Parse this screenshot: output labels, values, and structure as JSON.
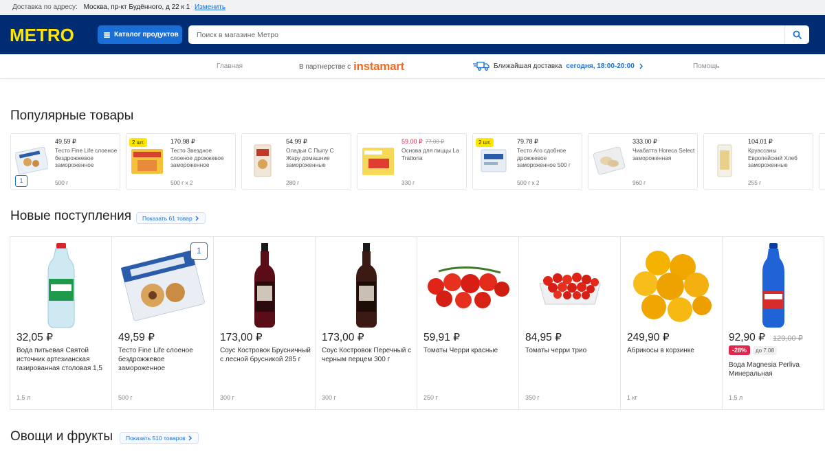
{
  "address_bar": {
    "label": "Доставка по адресу:",
    "address": "Москва, пр-кт Будённого, д 22 к 1",
    "change": "Изменить"
  },
  "header": {
    "logo": "METRO",
    "catalog_label": "Каталог продуктов",
    "search_placeholder": "Поиск в магазине Метро"
  },
  "nav": {
    "home": "Главная",
    "partner_prefix": "В партнерстве с",
    "partner_brand": "instamart",
    "delivery_label": "Ближайшая доставка",
    "delivery_time": "сегодня, 18:00-20:00",
    "help": "Помощь"
  },
  "popular": {
    "title": "Популярные товары",
    "items": [
      {
        "price": "49.59 ₽",
        "name": "Тесто Fine Life слоеное бездрожжевое замороженное",
        "weight": "500 г",
        "qty": "1"
      },
      {
        "price": "170.98 ₽",
        "name": "Тесто Звездное слоеное дрожжевое замороженное",
        "weight": "500 г x 2",
        "multi": "2 шт."
      },
      {
        "price": "54.99 ₽",
        "name": "Оладьи С Пылу С Жару домашние замороженные",
        "weight": "280 г"
      },
      {
        "price": "59.00 ₽",
        "old": "77.00 ₽",
        "name": "Основа для пиццы La Trattoria",
        "weight": "330 г"
      },
      {
        "price": "79.78 ₽",
        "name": "Тесто Aro сдобное дрожжевое замороженное 500 г",
        "weight": "500 г x 2",
        "multi": "2 шт."
      },
      {
        "price": "333.00 ₽",
        "name": "Чиабатта Horeca Select замороженная",
        "weight": "960 г"
      },
      {
        "price": "104.01 ₽",
        "name": "Круассаны Европейский Хлеб замороженные",
        "weight": "255 г"
      }
    ]
  },
  "new_arrivals": {
    "title": "Новые поступления",
    "show_all": "Показать 61 товар",
    "items": [
      {
        "price": "32,05 ₽",
        "name": "Вода питьевая Святой источник артезианская газированная столовая 1,5",
        "weight": "1,5 л"
      },
      {
        "price": "49,59 ₽",
        "name": "Тесто Fine Life слоеное бездрожжевое замороженное",
        "weight": "500 г",
        "qty": "1"
      },
      {
        "price": "173,00 ₽",
        "name": "Соус Костровок Брусничный с лесной брусникой 285 г",
        "weight": "300 г"
      },
      {
        "price": "173,00 ₽",
        "name": "Соус Костровок Перечный с черным перцем 300 г",
        "weight": "300 г"
      },
      {
        "price": "59,91 ₽",
        "name": "Томаты Черри красные",
        "weight": "250 г"
      },
      {
        "price": "84,95 ₽",
        "name": "Томаты черри трио",
        "weight": "350 г"
      },
      {
        "price": "249,90 ₽",
        "name": "Абрикосы в корзинке",
        "weight": "1 кг"
      },
      {
        "price": "92,90 ₽",
        "old": "129,00 ₽",
        "discount": "-28%",
        "until": "до 7.08",
        "name": "Вода Magnesia Perliva Минеральная",
        "weight": "1,5 л"
      }
    ]
  },
  "veg": {
    "title": "Овощи и фрукты",
    "show_all": "Показать 510 товаров"
  },
  "colors": {
    "header_bg": "#002d72",
    "logo": "#ffe600",
    "accent": "#1a6fd6",
    "sale": "#e2254d",
    "instamart": "#f26b21"
  }
}
